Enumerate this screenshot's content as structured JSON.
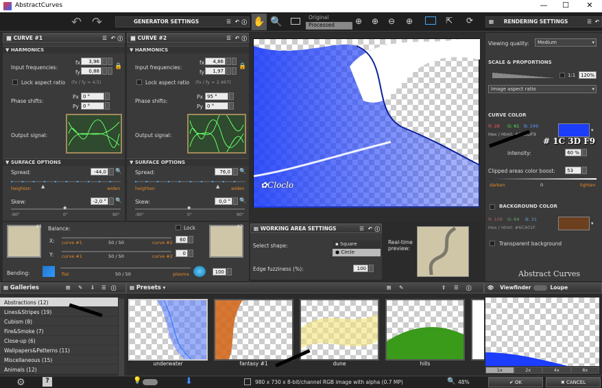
{
  "window": {
    "title": "AbstractCurves",
    "minimize": "—",
    "maximize": "☐",
    "close": "✕"
  },
  "toolbar": {
    "generator_settings": "GENERATOR SETTINGS",
    "rendering_settings": "RENDERING SETTINGS",
    "original": "Original",
    "processed": "Processed"
  },
  "curve1": {
    "title": "CURVE #1",
    "harmonics": "HARMONICS",
    "input_freq": "Input frequencies:",
    "fx": "3,96",
    "fy": "0,88",
    "lock_aspect": "Lock aspect ratio",
    "ratio": "(fx / fy = 4.5)",
    "phase": "Phase shifts:",
    "px": "0 °",
    "py": "0 °",
    "output": "Output signal:",
    "surface": "SURFACE OPTIONS",
    "spread_l": "Spread:",
    "spread": "-44,0",
    "heighten": "heighten",
    "widen": "widen",
    "skew_l": "Skew:",
    "skew": "-2,0 °",
    "m90": "-90°",
    "z": "0°",
    "p90": "90°"
  },
  "curve2": {
    "title": "CURVE #2",
    "harmonics": "HARMONICS",
    "input_freq": "Input frequencies:",
    "fx": "4,86",
    "fy": "1,97",
    "lock_aspect": "Lock aspect ratio",
    "ratio": "(fx / fy = 2.467)",
    "phase": "Phase shifts:",
    "px": "95 °",
    "py": "0 °",
    "output": "Output signal:",
    "surface": "SURFACE OPTIONS",
    "spread_l": "Spread:",
    "spread": "76,0",
    "heighten": "heighten",
    "widen": "widen",
    "skew_l": "Skew:",
    "skew": "0,0 °",
    "m90": "-90°",
    "z": "0°",
    "p90": "90°"
  },
  "balance": {
    "label": "Balance:",
    "lock": "Lock",
    "x": "X:",
    "y": "Y:",
    "c1": "curve #1",
    "c2": "curve #2",
    "ratio": "50 / 50",
    "x_val": "60",
    "y_val": "0",
    "num1": "#1",
    "num2": "#2"
  },
  "bending": {
    "label": "Bending:",
    "flat": "flat",
    "plasma": "plasma",
    "ratio": "50 / 50",
    "value": "100"
  },
  "working": {
    "title": "WORKING AREA SETTINGS",
    "shape": "Select shape:",
    "square": "Square",
    "circle": "Circle",
    "fuzz": "Edge fuzziness (%):",
    "fuzz_val": "100",
    "preview": "Real-time preview:"
  },
  "rendering": {
    "quality_l": "Viewing quality:",
    "quality": "Medium",
    "scale": "SCALE & PROPORTIONS",
    "oneone": "1:1",
    "zoom": "120%",
    "aspect": "Image aspect ratio",
    "curve_color": "CURVE COLOR",
    "r": "R: 28",
    "g": "G: 61",
    "b": "B: 249",
    "hex": "Hex / Html: #1C3DF9",
    "hex_annot": "# 1C 3D F9",
    "intensity": "intensity:",
    "int_val": "60 %",
    "clipped": "Clipped areas color boost:",
    "clip_val": "53",
    "darken": "darken",
    "zero": "0",
    "lighten": "lighten",
    "bg_color": "BACKGROUND COLOR",
    "bg_r": "R: 108",
    "bg_g": "G: 64",
    "bg_b": "B: 31",
    "bg_hex": "Hex / Html: #6C401F",
    "transparent": "Transparent background",
    "brand": "Abstract Curves"
  },
  "galleries": {
    "title": "Galleries",
    "items": [
      "Abstractions (12)",
      "Lines&Stripes (19)",
      "Cubism (8)",
      "Fire&Smoke (7)",
      "Close-up (6)",
      "Wallpapers&Patterns (11)",
      "Miscellaneous (15)",
      "Animals (12)"
    ]
  },
  "presets": {
    "title": "Presets",
    "thumbs": [
      "underwater",
      "fantasy #1",
      "dune",
      "hills"
    ]
  },
  "viewfinder": {
    "title": "Viewfinder",
    "loupe": "Loupe",
    "zooms": [
      "1x",
      "2x",
      "4x",
      "8x"
    ]
  },
  "status": {
    "info": "980 x 730 x 8-bit/channel RGB image with alpha  (0.7 MP)",
    "zoom": "48%",
    "ok": "OK",
    "cancel": "CANCEL"
  },
  "colors": {
    "curve": "#1C3DF9",
    "background": "#6C401F",
    "accent": "#e98a2a"
  }
}
